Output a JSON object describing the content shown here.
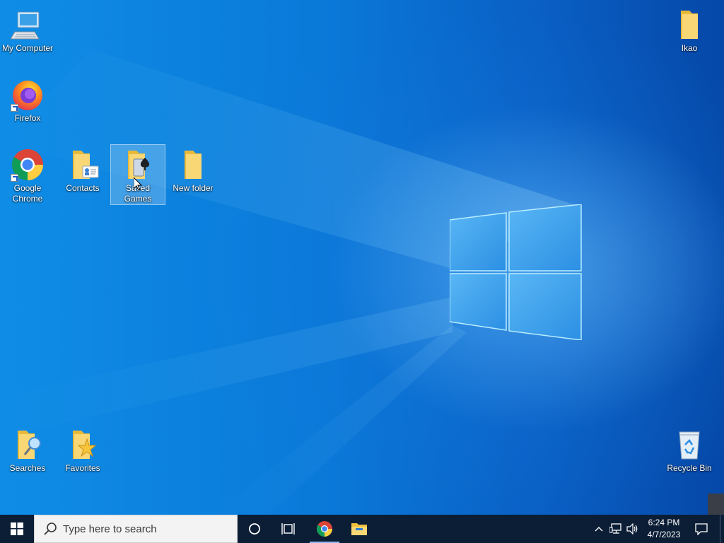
{
  "desktop": {
    "icons": [
      {
        "label": "My Computer",
        "icon": "computer-icon"
      },
      {
        "label": "Firefox",
        "icon": "firefox-icon"
      },
      {
        "label": "Google Chrome",
        "icon": "chrome-icon"
      },
      {
        "label": "Contacts",
        "icon": "contacts-folder-icon"
      },
      {
        "label": "Saved Games",
        "icon": "saved-games-folder-icon",
        "selected": true
      },
      {
        "label": "New folder",
        "icon": "folder-icon"
      },
      {
        "label": "Ikao",
        "icon": "folder-icon"
      },
      {
        "label": "Searches",
        "icon": "searches-folder-icon"
      },
      {
        "label": "Favorites",
        "icon": "favorites-folder-icon"
      },
      {
        "label": "Recycle Bin",
        "icon": "recycle-bin-icon"
      }
    ]
  },
  "taskbar": {
    "search_placeholder": "Type here to search",
    "clock": {
      "time": "6:24 PM",
      "date": "4/7/2023"
    },
    "pinned": [
      "start-icon",
      "cortana-icon",
      "task-view-icon",
      "chrome-icon",
      "file-explorer-icon"
    ],
    "tray": [
      "chevron-up-icon",
      "network-icon",
      "volume-icon",
      "notification-icon"
    ]
  },
  "colors": {
    "taskbar": "#0b1e36",
    "desktop_accent": "#0a79d8",
    "folder_yellow": "#f5c94a"
  }
}
